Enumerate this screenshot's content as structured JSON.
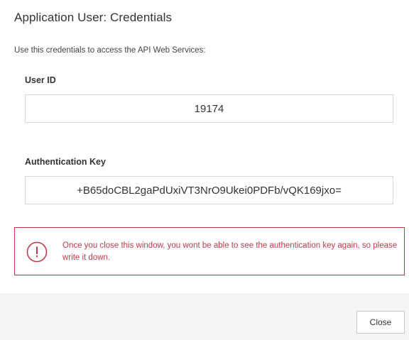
{
  "dialog": {
    "title": "Application User: Credentials",
    "intro": "Use this credentials to access the API Web Services:"
  },
  "fields": {
    "user_id": {
      "label": "User ID",
      "value": "19174"
    },
    "auth_key": {
      "label": "Authentication Key",
      "value": "+B65doCBL2gaPdUxiVT3NrO9Ukei0PDFb/vQK169jxo="
    }
  },
  "warning": {
    "icon": "exclamation-circle-icon",
    "text": "Once you close this window, you wont be able to see the authentication key again, so please write it down.",
    "color": "#c2394a"
  },
  "footer": {
    "close_label": "Close"
  }
}
